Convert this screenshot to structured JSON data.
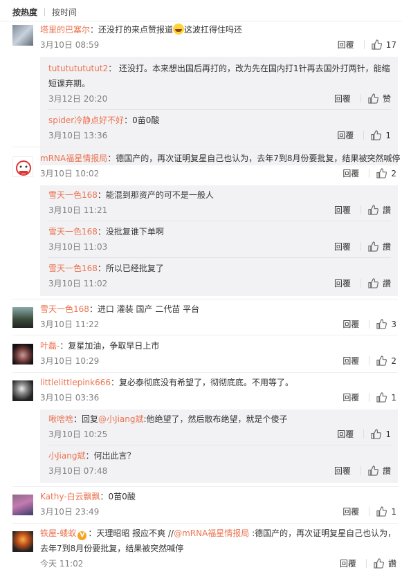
{
  "sort": {
    "active": "按热度",
    "other": "按时间"
  },
  "actions": {
    "reply": "回覆"
  },
  "colors": {
    "name": "#eb7350",
    "time": "#808080",
    "subBg": "#f2f2f5"
  },
  "comments": [
    {
      "name": "塔里的巴塞尔",
      "text": "：还没打的来点赞报道",
      "text_after_emoji": "这波扛得住吗还",
      "emoji": "grinning-emoji",
      "time": "3月10日 08:59",
      "likes": "17",
      "replies": [
        {
          "name": "tutututututut2",
          "text": "： 还没打。本来想出国后再打的，改为先在国内打1针再去国外打两针，能缩短课弃期。",
          "time": "3月12日 20:20",
          "likes": "赞"
        },
        {
          "name": "spider冷静点好不好",
          "text": "：0苗0酸",
          "time": "3月10日 13:36",
          "likes": "1"
        }
      ]
    },
    {
      "name": "mRNA福星情报局",
      "text": "：德国产的，再次证明复星自己也认为，去年7到8月份要批复，结果被突然喊停",
      "time": "3月10日 10:02",
      "likes": "2",
      "replies": [
        {
          "name": "雪天一色168",
          "text": "：能混到那资产的可不是一般人",
          "time": "3月10日 11:21",
          "likes": "讚"
        },
        {
          "name": "雪天一色168",
          "text": "：没批复谁下单啊",
          "time": "3月10日 11:03",
          "likes": "讚"
        },
        {
          "name": "雪天一色168",
          "text": "：所以已经批复了",
          "time": "3月10日 11:02",
          "likes": "讚"
        }
      ]
    },
    {
      "name": "雪天一色168",
      "text": "：进口 灌装 国产 二代苗 平台",
      "time": "3月10日 11:22",
      "likes": "3"
    },
    {
      "name": "叶磊-",
      "text": "：复星加油，争取早日上市",
      "time": "3月10日 10:29",
      "likes": "2"
    },
    {
      "name": "littlelittlepink666",
      "text": "：复必泰彻底没有希望了，彻彻底底。不用等了。",
      "time": "3月10日 03:36",
      "likes": "1",
      "replies": [
        {
          "name": "啾啥啥",
          "text_prefix": "：回复",
          "mention": "@小Jiang斌",
          "text": ":他绝望了，然后散布绝望，就是个傻子",
          "time": "3月10日 10:25",
          "likes": "1"
        },
        {
          "name": "小Jiang斌",
          "text": "：何出此言？",
          "time": "3月10日 07:48",
          "likes": "讚"
        }
      ]
    },
    {
      "name": "Kathy-白云飘飘",
      "text": "：0苗0酸",
      "time": "3月10日 23:49",
      "likes": "1"
    },
    {
      "name": "铁屋-蝼蚁",
      "vip": "V",
      "text_prefix": "：天理昭昭 报应不爽 //",
      "mention": "@mRNA福星情报局",
      "text": " :德国产的，再次证明复星自己也认为，去年7到8月份要批复，结果被突然喊停",
      "time": "今天 11:02",
      "likes": "讚"
    }
  ]
}
